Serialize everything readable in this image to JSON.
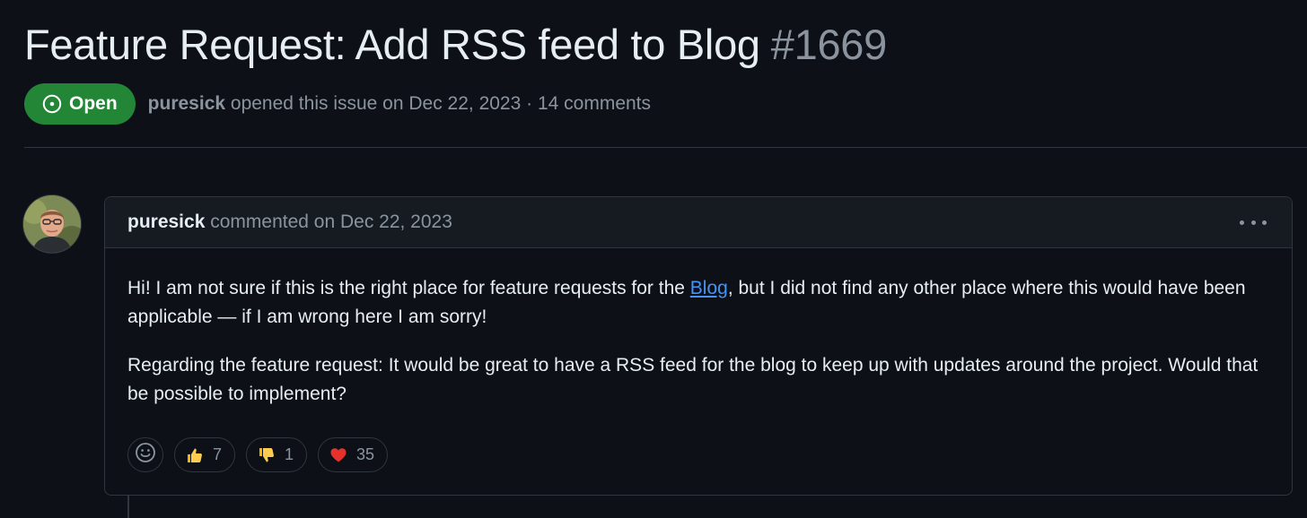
{
  "issue": {
    "title": "Feature Request: Add RSS feed to Blog",
    "number": "#1669",
    "state": "Open",
    "author": "puresick",
    "opened_text": " opened this issue on Dec 22, 2023 · 14 comments"
  },
  "comment": {
    "author": "puresick",
    "action_text": " commented on Dec 22, 2023",
    "body": {
      "p1_before": "Hi! I am not sure if this is the right place for feature requests for the ",
      "p1_link": "Blog",
      "p1_after": ", but I did not find any other place where this would have been applicable — if I am wrong here I am sorry!",
      "p2": "Regarding the feature request: It would be great to have a RSS feed for the blog to keep up with updates around the project. Would that be possible to implement?"
    },
    "reactions": [
      {
        "emoji": "thumbs-up-icon",
        "count": "7"
      },
      {
        "emoji": "thumbs-down-icon",
        "count": "1"
      },
      {
        "emoji": "heart-icon",
        "count": "35"
      }
    ]
  },
  "icons": {
    "state": "issue-opened-icon",
    "menu": "kebab-horizontal-icon",
    "add_reaction": "smiley-icon"
  },
  "colors": {
    "background": "#0d1117",
    "open_badge": "#238636",
    "link": "#4493f8",
    "muted": "#8b949e",
    "border": "#30363d"
  }
}
